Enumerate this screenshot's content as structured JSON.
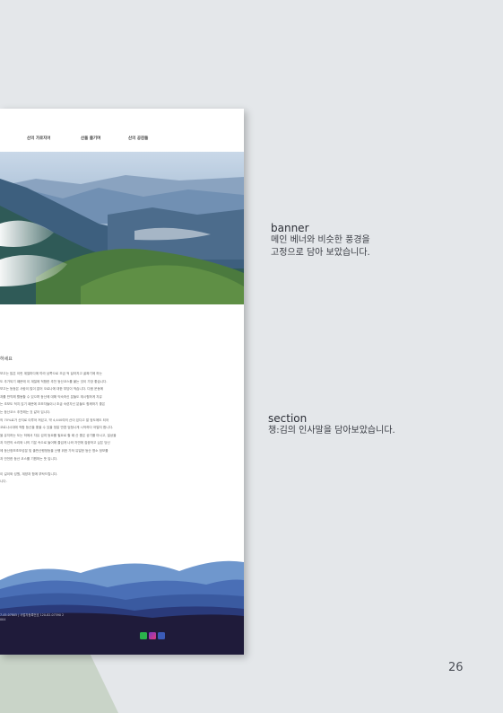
{
  "mockup": {
    "nav": [
      "산의 가로지어",
      "산을 즐기며",
      "산의 공감들"
    ],
    "section_title": "하세요",
    "body_lines": [
      "보고는 많은 이런 계절마다에 따라 남쪽으로 조금 씩 달라지고 골짜기에 하는",
      "도 추가되기 때문에 이 계절에 적합한 추천 등산코스를 붙는 것이 가장 좋습니다.",
      "보고는 등등은 사람이 많이 없어 오로나에 대한 부담이 적습니다. 다음 운동에",
      "과를 만끽해 활동할 수 있으며 등산에 대해 익숙하신 분들도 재시험하게 자유",
      "는 초보도 적지 않기 때문에 초보자들이나 초급 숙련자신 분들도 함께하기 좋은",
      "는 등산코스 추천해는 것 같아 입니다.",
      "의 70%로가 산지로 이루어 져있고, 약 4,440여의 산이 있다고 알 정도에도 되어",
      "코로나시대에 적합 등산을 좋을 수 있을 정말 만큼 엄청나게 시작하다 어떨지 합니다.",
      "을 유지하는 도는 하에서 자유 섬여 등요를 필요로 할 때 산 좋은 공기를 마시고, 일상을",
      "과 자연의 소리와 나의 기분 속으로 들어해 즐겁게 나와 자연에 집중하고 싶은 당신",
      "에 등산정보초보성분 및 출판산행정등을 산행 위한 가져 유일한 등산 명소 정보를",
      "과 안전한 등산 코스를 기원하는 뜻 입니다.",
      "",
      "이 길이와 성원, 계양과 함께 부탁드립니다.",
      "니다."
    ],
    "footer_lines": [
      "7-45-07805  |  사업자등록번호 120-82-07590 2",
      "004"
    ]
  },
  "annotations": {
    "banner": {
      "title": "banner",
      "desc_line1": "메인 베너와 비슷한 풍경을",
      "desc_line2": "고정으로 담아 보았습니다."
    },
    "section": {
      "title": "section",
      "desc": "챙:김의 인사말을 담아보았습니다."
    }
  },
  "page_number": "26",
  "colors": {
    "background": "#e4e7ea",
    "triangle": "#c9d4c8",
    "footer_dark": "#1f1b3a",
    "wave_light": "#6f97cd",
    "wave_mid": "#3a5aa0",
    "wave_deep": "#2a3a7a"
  },
  "icons": [
    "chat-icon",
    "instagram-icon",
    "facebook-icon"
  ]
}
